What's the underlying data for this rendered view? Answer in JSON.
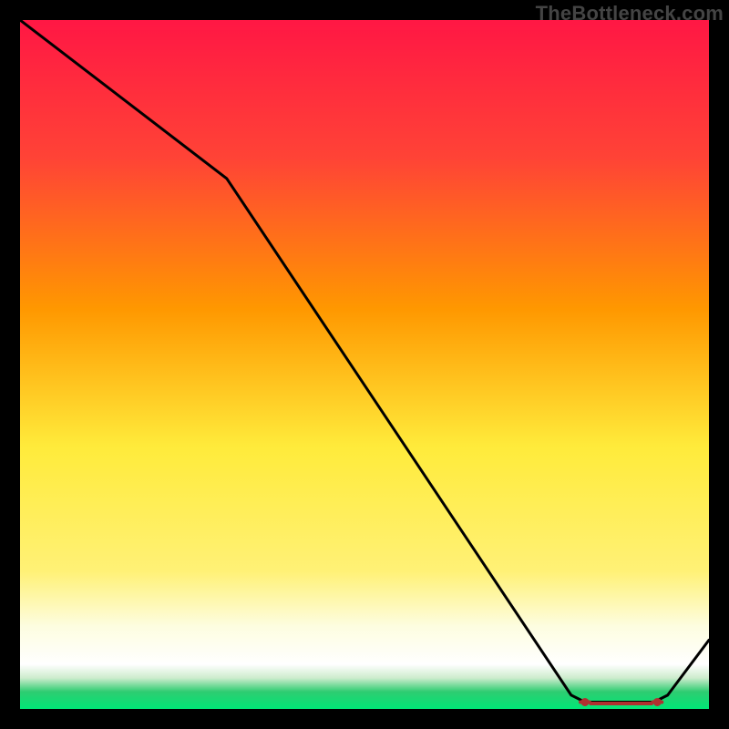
{
  "watermark": "TheBottleneck.com",
  "chart_data": {
    "type": "line",
    "title": "",
    "xlabel": "",
    "ylabel": "",
    "xlim": [
      0,
      100
    ],
    "ylim": [
      0,
      100
    ],
    "grid": false,
    "legend": false,
    "gradient_stops": [
      {
        "offset": 0,
        "color": "#ff1744"
      },
      {
        "offset": 0.2,
        "color": "#ff4336"
      },
      {
        "offset": 0.42,
        "color": "#ff9800"
      },
      {
        "offset": 0.62,
        "color": "#ffeb3b"
      },
      {
        "offset": 0.8,
        "color": "#fff176"
      },
      {
        "offset": 0.88,
        "color": "#fdfde0"
      },
      {
        "offset": 0.935,
        "color": "#ffffff"
      },
      {
        "offset": 0.955,
        "color": "#cdeccd"
      },
      {
        "offset": 0.975,
        "color": "#2ecc71"
      },
      {
        "offset": 1.0,
        "color": "#00e676"
      }
    ],
    "series": [
      {
        "name": "bottleneck-curve",
        "x": [
          0,
          30,
          80,
          82,
          92,
          94,
          100
        ],
        "y": [
          100,
          77,
          2,
          1,
          1,
          2,
          10
        ]
      }
    ],
    "markers": {
      "name": "optimal-range",
      "color": "#b03030",
      "points": [
        {
          "x": 82,
          "y": 1
        },
        {
          "x": 83.5,
          "y": 0.8
        },
        {
          "x": 85,
          "y": 0.8
        },
        {
          "x": 86.5,
          "y": 0.8
        },
        {
          "x": 88,
          "y": 0.8
        },
        {
          "x": 89.5,
          "y": 0.8
        },
        {
          "x": 91,
          "y": 0.8
        },
        {
          "x": 92.5,
          "y": 1.0
        }
      ]
    }
  }
}
